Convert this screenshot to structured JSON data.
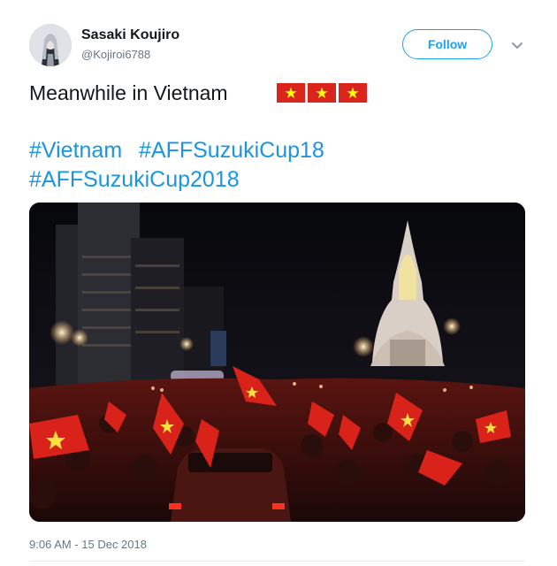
{
  "user": {
    "display_name": "Sasaki Koujiro",
    "handle": "@Kojiroi6788"
  },
  "follow_label": "Follow",
  "tweet": {
    "text": "Meanwhile in Vietnam",
    "flag_emoji_count": 3,
    "hashtags": [
      "#Vietnam",
      "#AFFSuzukiCup18",
      "#AFFSuzukiCup2018"
    ],
    "timestamp": "9:06 AM - 15 Dec 2018"
  },
  "colors": {
    "link": "#1b95e0",
    "follow_border": "#1da1f2",
    "secondary_text": "#657786",
    "flag_red": "#da251d",
    "flag_star": "#ffff00"
  },
  "icons": {
    "caret": "chevron-down-icon",
    "flag": "vietnam-flag-icon"
  }
}
